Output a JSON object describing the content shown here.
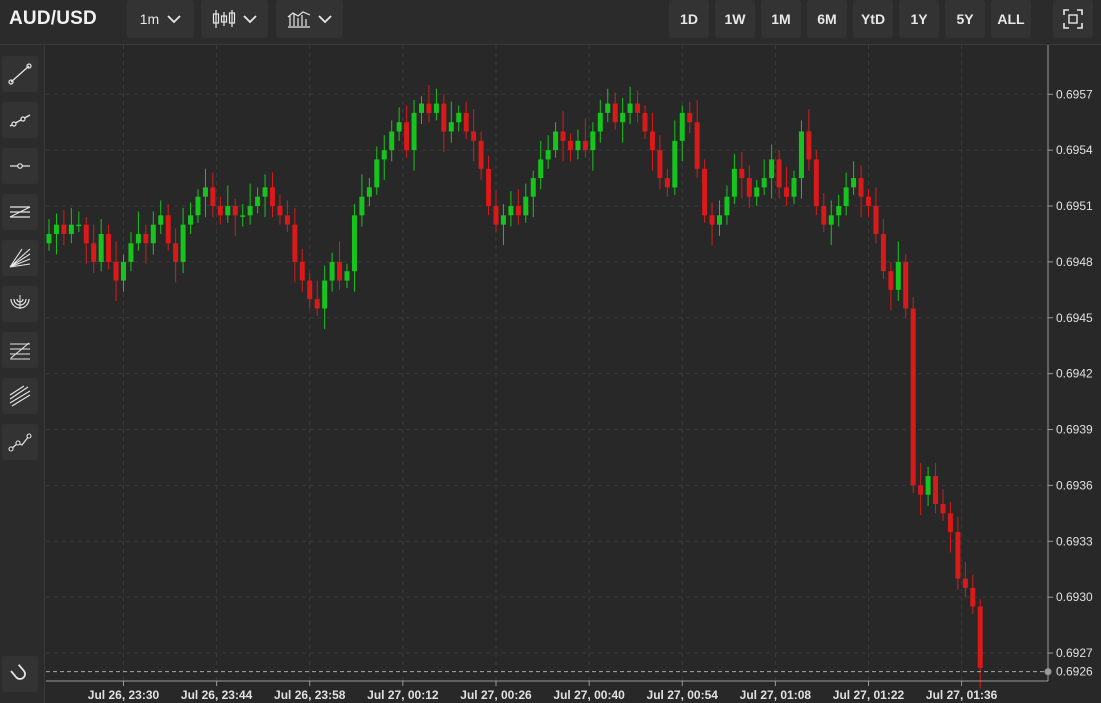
{
  "header": {
    "symbol": "AUD/USD",
    "interval": "1m",
    "ranges": [
      "1D",
      "1W",
      "1M",
      "6M",
      "YtD",
      "1Y",
      "5Y",
      "ALL"
    ],
    "icons": {
      "interval_chevron": "chevron-down-icon",
      "chart_type": "candlestick-icon",
      "indicators": "indicators-icon",
      "fullscreen": "fullscreen-icon"
    }
  },
  "sidebar": {
    "tools": [
      "trend-line-icon",
      "ray-line-icon",
      "horizontal-line-icon",
      "parallel-channel-icon",
      "fan-icon",
      "arc-icon",
      "fibonacci-icon",
      "pitchfork-icon",
      "path-icon"
    ],
    "bottom_tool": "magnet-icon"
  },
  "colors": {
    "background": "#282828",
    "up": "#17c41d",
    "down": "#d91a1a",
    "grid": "#3a3a3a",
    "text": "#e0e0e0"
  },
  "chart_data": {
    "type": "candlestick",
    "title": "AUD/USD",
    "x_ticks": [
      "Jul 26, 23:30",
      "Jul 26, 23:44",
      "Jul 26, 23:58",
      "Jul 27, 00:12",
      "Jul 27, 00:26",
      "Jul 27, 00:40",
      "Jul 27, 00:54",
      "Jul 27, 01:08",
      "Jul 27, 01:22",
      "Jul 27, 01:36"
    ],
    "y_ticks": [
      "0.6957",
      "0.6954",
      "0.6951",
      "0.6948",
      "0.6945",
      "0.6942",
      "0.6939",
      "0.6936",
      "0.6933",
      "0.6930",
      "0.6927"
    ],
    "last_price": "0.6926",
    "ylim": [
      0.69255,
      0.6959
    ],
    "grid": true,
    "close": [
      0.69495,
      0.695,
      0.69495,
      0.695,
      0.695,
      0.6949,
      0.6948,
      0.69495,
      0.6948,
      0.6947,
      0.6948,
      0.6949,
      0.69495,
      0.6949,
      0.695,
      0.69505,
      0.6949,
      0.6948,
      0.695,
      0.69505,
      0.69515,
      0.6952,
      0.6951,
      0.69505,
      0.6951,
      0.69505,
      0.69505,
      0.6951,
      0.69515,
      0.6952,
      0.6951,
      0.69505,
      0.695,
      0.6948,
      0.6947,
      0.6946,
      0.69455,
      0.6947,
      0.6948,
      0.6947,
      0.69475,
      0.69505,
      0.69515,
      0.6952,
      0.69535,
      0.6954,
      0.6955,
      0.69555,
      0.6954,
      0.6956,
      0.69565,
      0.6956,
      0.69565,
      0.6955,
      0.69555,
      0.6956,
      0.6955,
      0.69545,
      0.6953,
      0.6951,
      0.695,
      0.69505,
      0.6951,
      0.69505,
      0.69515,
      0.69525,
      0.69535,
      0.6954,
      0.6955,
      0.69545,
      0.6954,
      0.69545,
      0.6954,
      0.6955,
      0.6956,
      0.69565,
      0.69555,
      0.6956,
      0.69565,
      0.6956,
      0.6955,
      0.6954,
      0.69525,
      0.6952,
      0.69545,
      0.6956,
      0.69555,
      0.6953,
      0.69505,
      0.695,
      0.69505,
      0.69515,
      0.6953,
      0.69525,
      0.69515,
      0.6952,
      0.69525,
      0.69535,
      0.6952,
      0.69515,
      0.69525,
      0.6955,
      0.69535,
      0.6951,
      0.695,
      0.69505,
      0.6951,
      0.6952,
      0.69525,
      0.69515,
      0.6951,
      0.69495,
      0.69475,
      0.69465,
      0.6948,
      0.69455,
      0.6936,
      0.69355,
      0.69365,
      0.6935,
      0.69345,
      0.69335,
      0.6931,
      0.69305,
      0.69295,
      0.69262
    ]
  }
}
